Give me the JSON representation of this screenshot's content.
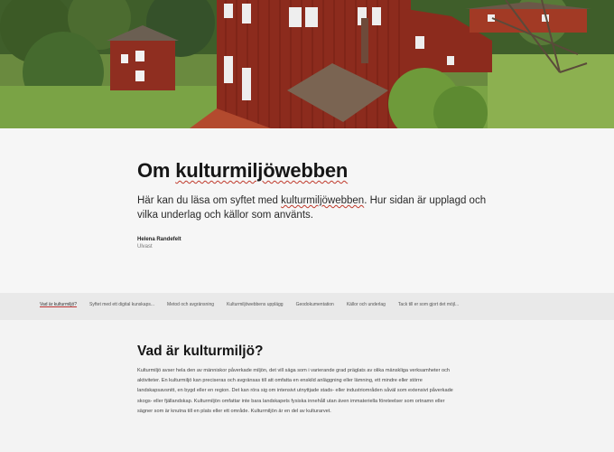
{
  "header": {
    "title_part1": "Om ",
    "title_part2": "kulturmiljöwebben",
    "lead_part1": "Här kan du läsa om syftet med ",
    "lead_link": "kulturmiljöwebben",
    "lead_part2": ". Hur sidan är upplagd och vilka underlag och källor som använts.",
    "author": "Helena Randefelt",
    "org": "Ulvast"
  },
  "nav": {
    "items": [
      "Vad är kulturmiljö?",
      "Syftet med ett digital kunskaps...",
      "Metod och avgränsning",
      "Kulturmiljöwebbens upplägg",
      "Geodokumentation",
      "Källor och underlag",
      "Tack till er som gjort det möjl..."
    ]
  },
  "section": {
    "title": "Vad är kulturmiljö?",
    "body": "Kulturmiljö avser hela den av människor påverkade miljön, det vill säga som i varierande grad präglats av olika mänskliga verksamheter och aktiviteter. En kulturmiljö kan preciseras och avgränsas till att omfatta en enskild anläggning eller lämning, ett mindre eller större landskapsavsnitt, en bygd eller en region. Det kan röra sig om intensivt utnyttjade stads- eller industriområden såväl som extensivt påverkade skogs- eller fjällandskap. Kulturmiljön omfattar inte bara landskapets fysiska innehåll utan även immateriella företeelser som ortnamn eller sägner som är knutna till en plats eller ett område. Kulturmiljön är en del av kulturarvet."
  },
  "colors": {
    "accent_underline": "#c0392b",
    "barn_red": "#8c2b1d"
  }
}
